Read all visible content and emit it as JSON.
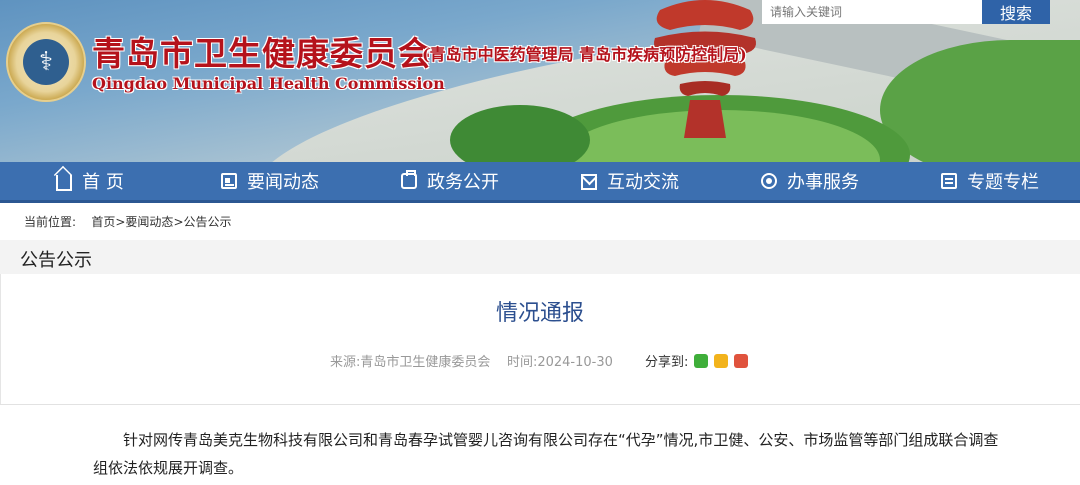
{
  "header": {
    "title_cn": "青岛市卫生健康委员会",
    "subtitle_cn": "(青岛市中医药管理局 青岛市疾病预防控制局)",
    "title_en": "Qingdao Municipal Health Commission",
    "logo_icon": "health-commission-emblem-icon"
  },
  "search": {
    "placeholder": "请输入关键词",
    "button_label": "搜索"
  },
  "nav": {
    "items": [
      {
        "label": "首 页",
        "icon": "home-icon"
      },
      {
        "label": "要闻动态",
        "icon": "news-icon"
      },
      {
        "label": "政务公开",
        "icon": "briefcase-icon"
      },
      {
        "label": "互动交流",
        "icon": "mail-icon"
      },
      {
        "label": "办事服务",
        "icon": "service-icon"
      },
      {
        "label": "专题专栏",
        "icon": "topic-icon"
      }
    ]
  },
  "breadcrumb": {
    "prefix": "当前位置:",
    "items": [
      "首页",
      "要闻动态",
      "公告公示"
    ],
    "sep": ">"
  },
  "section": {
    "title": "公告公示"
  },
  "article": {
    "title": "情况通报",
    "source": "来源:青岛市卫生健康委员会",
    "time": "时间:2024-10-30",
    "share_label": "分享到:",
    "share_icons": [
      "wechat-icon",
      "qzone-icon",
      "weibo-icon"
    ],
    "body": "针对网传青岛美克生物科技有限公司和青岛春孕试管婴儿咨询有限公司存在“代孕”情况,市卫健、公安、市场监管等部门组成联合调查组依法依规展开调查。"
  },
  "colors": {
    "nav_bg": "#3c6fb0",
    "title_red": "#b5121b",
    "article_title": "#2c4f8f"
  }
}
